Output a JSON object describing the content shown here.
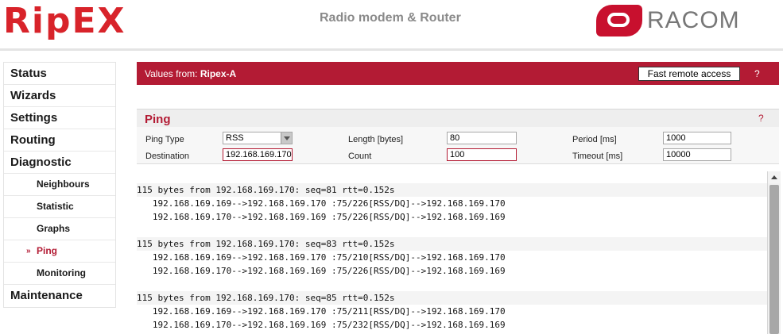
{
  "header": {
    "logo_left": "RipEX",
    "title": "Radio modem & Router",
    "logo_right": "RACOM"
  },
  "sidebar": {
    "items": [
      {
        "label": "Status"
      },
      {
        "label": "Wizards"
      },
      {
        "label": "Settings"
      },
      {
        "label": "Routing"
      },
      {
        "label": "Diagnostic"
      },
      {
        "label": "Neighbours"
      },
      {
        "label": "Statistic"
      },
      {
        "label": "Graphs"
      },
      {
        "label": "Ping"
      },
      {
        "label": "Monitoring"
      },
      {
        "label": "Maintenance"
      }
    ],
    "active_marker": "»"
  },
  "valbar": {
    "prefix": "Values from: ",
    "station": "Ripex-A",
    "fast_button": "Fast remote access",
    "help": "?"
  },
  "ping": {
    "title": "Ping",
    "help": "?",
    "ping_type_label": "Ping Type",
    "ping_type_value": "RSS",
    "destination_label": "Destination",
    "destination_value": "192.168.169.170",
    "length_label": "Length [bytes]",
    "length_value": "80",
    "count_label": "Count",
    "count_value": "100",
    "period_label": "Period [ms]",
    "period_value": "1000",
    "timeout_label": "Timeout [ms]",
    "timeout_value": "10000"
  },
  "output": {
    "lines": [
      "115 bytes from 192.168.169.170: seq=81 rtt=0.152s",
      "   192.168.169.169-->192.168.169.170 :75/226[RSS/DQ]-->192.168.169.170",
      "   192.168.169.170-->192.168.169.169 :75/226[RSS/DQ]-->192.168.169.169",
      "",
      "115 bytes from 192.168.169.170: seq=83 rtt=0.152s",
      "   192.168.169.169-->192.168.169.170 :75/210[RSS/DQ]-->192.168.169.170",
      "   192.168.169.170-->192.168.169.169 :75/226[RSS/DQ]-->192.168.169.169",
      "",
      "115 bytes from 192.168.169.170: seq=85 rtt=0.152s",
      "   192.168.169.169-->192.168.169.170 :75/211[RSS/DQ]-->192.168.169.170",
      "   192.168.169.170-->192.168.169.169 :75/232[RSS/DQ]-->192.168.169.169"
    ]
  },
  "colors": {
    "brand": "#b31b34",
    "logo_red": "#d8232a",
    "logo_gray": "#777777"
  }
}
